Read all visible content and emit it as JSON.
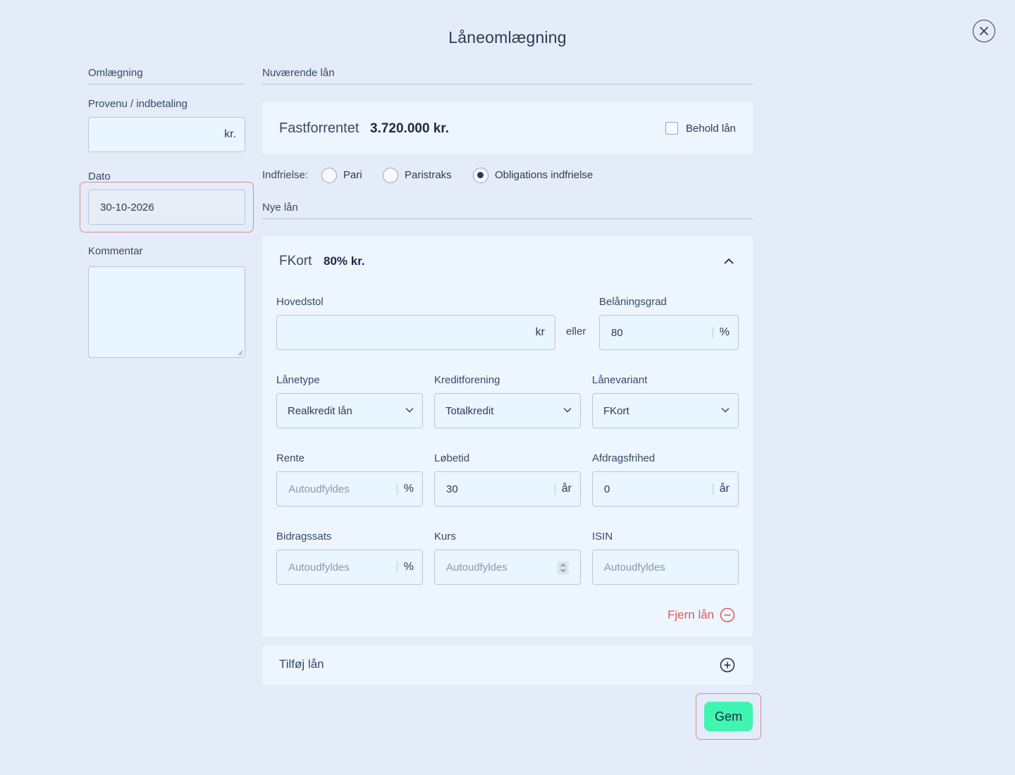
{
  "modal": {
    "title": "Låneomlægning"
  },
  "left": {
    "section_title": "Omlægning",
    "provenu": {
      "label": "Provenu / indbetaling",
      "value": "",
      "unit": "kr."
    },
    "dato": {
      "label": "Dato",
      "value": "30-10-2026"
    },
    "kommentar": {
      "label": "Kommentar",
      "value": ""
    }
  },
  "current_loans": {
    "section_title": "Nuværende lån",
    "loan": {
      "type": "Fastforrentet",
      "amount": "3.720.000 kr.",
      "keep_label": "Behold lån",
      "keep_checked": false
    },
    "indfrielse": {
      "label": "Indfrielse:",
      "options": [
        "Pari",
        "Paristraks",
        "Obligations indfrielse"
      ],
      "selected": "Obligations indfrielse"
    }
  },
  "new_loans": {
    "section_title": "Nye lån",
    "loan": {
      "name": "FKort",
      "amount": "80% kr.",
      "hovedstol": {
        "label": "Hovedstol",
        "value": "",
        "unit": "kr"
      },
      "or_label": "eller",
      "belaaningsgrad": {
        "label": "Belåningsgrad",
        "value": "80",
        "unit": "%"
      },
      "laanetype": {
        "label": "Lånetype",
        "value": "Realkredit lån"
      },
      "kreditforening": {
        "label": "Kreditforening",
        "value": "Totalkredit"
      },
      "laanevariant": {
        "label": "Lånevariant",
        "value": "FKort"
      },
      "rente": {
        "label": "Rente",
        "placeholder": "Autoudfyldes",
        "unit": "%"
      },
      "loebetid": {
        "label": "Løbetid",
        "value": "30",
        "unit": "år"
      },
      "afdragsfrihed": {
        "label": "Afdragsfrihed",
        "value": "0",
        "unit": "år"
      },
      "bidragssats": {
        "label": "Bidragssats",
        "placeholder": "Autoudfyldes",
        "unit": "%"
      },
      "kurs": {
        "label": "Kurs",
        "placeholder": "Autoudfyldes"
      },
      "isin": {
        "label": "ISIN",
        "placeholder": "Autoudfyldes"
      },
      "remove_label": "Fjern lån"
    },
    "add_label": "Tilføj lån"
  },
  "actions": {
    "save_label": "Gem"
  },
  "colors": {
    "background": "#e3ecf8",
    "save_button": "#3ff5b0",
    "danger": "#d9595b",
    "highlight_border": "#d98a8e"
  }
}
